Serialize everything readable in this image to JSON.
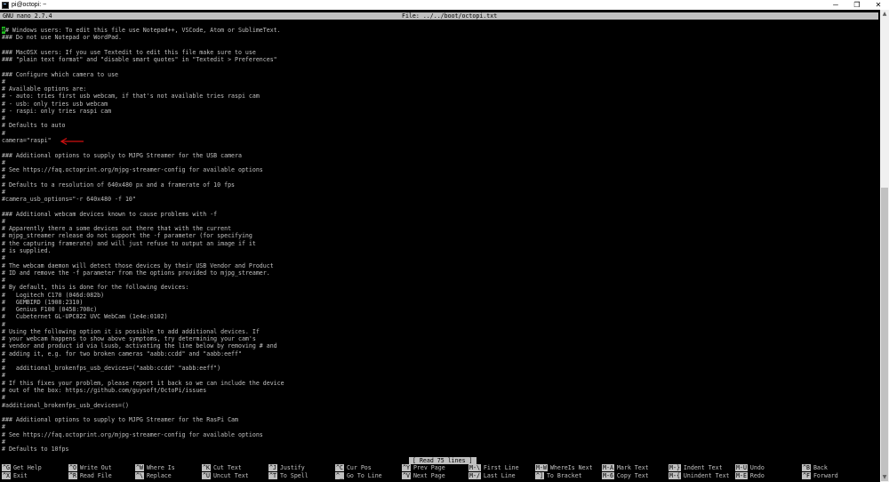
{
  "window": {
    "title": "pi@octopi: ~",
    "buttons": [
      "─",
      "❐",
      "✕"
    ]
  },
  "nano": {
    "version": "GNU nano 2.7.4",
    "file": "File: ../../boot/octopi.txt",
    "status": "[ Read 75 lines ]"
  },
  "editor": {
    "cursor_char": "#",
    "lines": [
      "## Windows users: To edit this file use Notepad++, VSCode, Atom or SublimeText.",
      "### Do not use Notepad or WordPad.",
      "",
      "### MacOSX users: If you use Textedit to edit this file make sure to use",
      "### \"plain text format\" and \"disable smart quotes\" in \"Textedit > Preferences\"",
      "",
      "### Configure which camera to use",
      "#",
      "# Available options are:",
      "# - auto: tries first usb webcam, if that's not available tries raspi cam",
      "# - usb: only tries usb webcam",
      "# - raspi: only tries raspi cam",
      "#",
      "# Defaults to auto",
      "#",
      "camera=\"raspi\"",
      "",
      "### Additional options to supply to MJPG Streamer for the USB camera",
      "#",
      "# See https://faq.octoprint.org/mjpg-streamer-config for available options",
      "#",
      "# Defaults to a resolution of 640x480 px and a framerate of 10 fps",
      "#",
      "#camera_usb_options=\"-r 640x480 -f 10\"",
      "",
      "### Additional webcam devices known to cause problems with -f",
      "#",
      "# Apparently there a some devices out there that with the current",
      "# mjpg_streamer release do not support the -f parameter (for specifying",
      "# the capturing framerate) and will just refuse to output an image if it",
      "# is supplied.",
      "#",
      "# The webcam daemon will detect those devices by their USB Vendor and Product",
      "# ID and remove the -f parameter from the options provided to mjpg_streamer.",
      "#",
      "# By default, this is done for the following devices:",
      "#   Logitech C170 (046d:082b)",
      "#   GEMBIRD (1908:2310)",
      "#   Genius F100 (0458:708c)",
      "#   Cubeternet GL-UPC822 UVC WebCam (1e4e:0102)",
      "#",
      "# Using the following option it is possible to add additional devices. If",
      "# your webcam happens to show above symptoms, try determining your cam's",
      "# vendor and product id via lsusb, activating the line below by removing # and",
      "# adding it, e.g. for two broken cameras \"aabb:ccdd\" and \"aabb:eeff\"",
      "#",
      "#   additional_brokenfps_usb_devices=(\"aabb:ccdd\" \"aabb:eeff\")",
      "#",
      "# If this fixes your problem, please report it back so we can include the device",
      "# out of the box: https://github.com/guysoft/OctoPi/issues",
      "#",
      "#additional_brokenfps_usb_devices=()",
      "",
      "### Additional options to supply to MJPG Streamer for the RasPi Cam",
      "#",
      "# See https://faq.octoprint.org/mjpg-streamer-config for available options",
      "#",
      "# Defaults to 10fps"
    ]
  },
  "shortcuts": [
    {
      "key": "^G",
      "label": "Get Help"
    },
    {
      "key": "^X",
      "label": "Exit"
    },
    {
      "key": "^O",
      "label": "Write Out"
    },
    {
      "key": "^R",
      "label": "Read File"
    },
    {
      "key": "^W",
      "label": "Where Is"
    },
    {
      "key": "^\\",
      "label": "Replace"
    },
    {
      "key": "^K",
      "label": "Cut Text"
    },
    {
      "key": "^U",
      "label": "Uncut Text"
    },
    {
      "key": "^J",
      "label": "Justify"
    },
    {
      "key": "^T",
      "label": "To Spell"
    },
    {
      "key": "^C",
      "label": "Cur Pos"
    },
    {
      "key": "^_",
      "label": "Go To Line"
    },
    {
      "key": "^Y",
      "label": "Prev Page"
    },
    {
      "key": "^V",
      "label": "Next Page"
    },
    {
      "key": "M-\\",
      "label": "First Line"
    },
    {
      "key": "M-/",
      "label": "Last Line"
    },
    {
      "key": "M-W",
      "label": "WhereIs Next"
    },
    {
      "key": "^]",
      "label": "To Bracket"
    },
    {
      "key": "M-A",
      "label": "Mark Text"
    },
    {
      "key": "M-6",
      "label": "Copy Text"
    },
    {
      "key": "M-}",
      "label": "Indent Text"
    },
    {
      "key": "M-{",
      "label": "Unindent Text"
    },
    {
      "key": "M-U",
      "label": "Undo"
    },
    {
      "key": "M-E",
      "label": "Redo"
    },
    {
      "key": "^B",
      "label": "Back"
    },
    {
      "key": "^F",
      "label": "Forward"
    }
  ],
  "annotation": {
    "arrow_color": "#d01010",
    "arrow_icon": "left-arrow"
  },
  "colors": {
    "background": "#000000",
    "text": "#c0c0c0",
    "inverse_bg": "#c0c0c0",
    "cursor": "#20c020"
  }
}
